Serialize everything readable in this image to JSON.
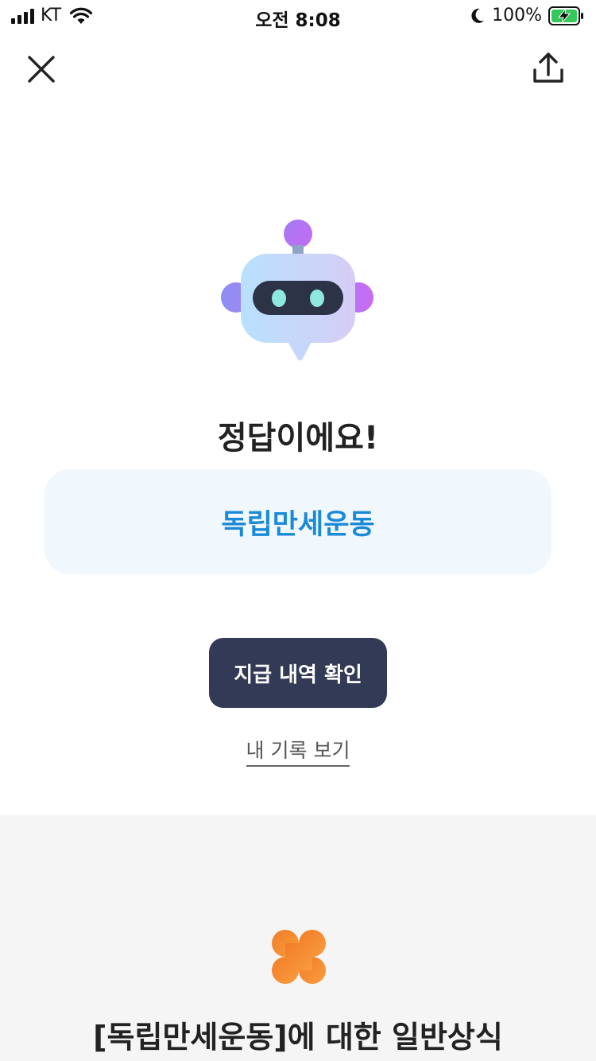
{
  "status_bar": {
    "carrier": "KT",
    "time": "오전 8:08",
    "battery": "100%",
    "icons": [
      "signal-icon",
      "wifi-icon",
      "moon-icon",
      "battery-charging-icon"
    ]
  },
  "nav": {
    "close_icon": "close-icon",
    "share_icon": "share-upload-icon"
  },
  "result": {
    "mascot_icon": "robot-mascot-icon",
    "title": "정답이에요!",
    "answer": "독립만세운동",
    "answer_color": "#1b8ad6",
    "primary_button": "지급 내역 확인",
    "primary_button_color": "#333a55",
    "secondary_link": "내 기록 보기"
  },
  "info": {
    "icon": "clover-icon",
    "icon_color": "#f28a2c",
    "title": "[독립만세운동]에 대한 일반상식"
  }
}
